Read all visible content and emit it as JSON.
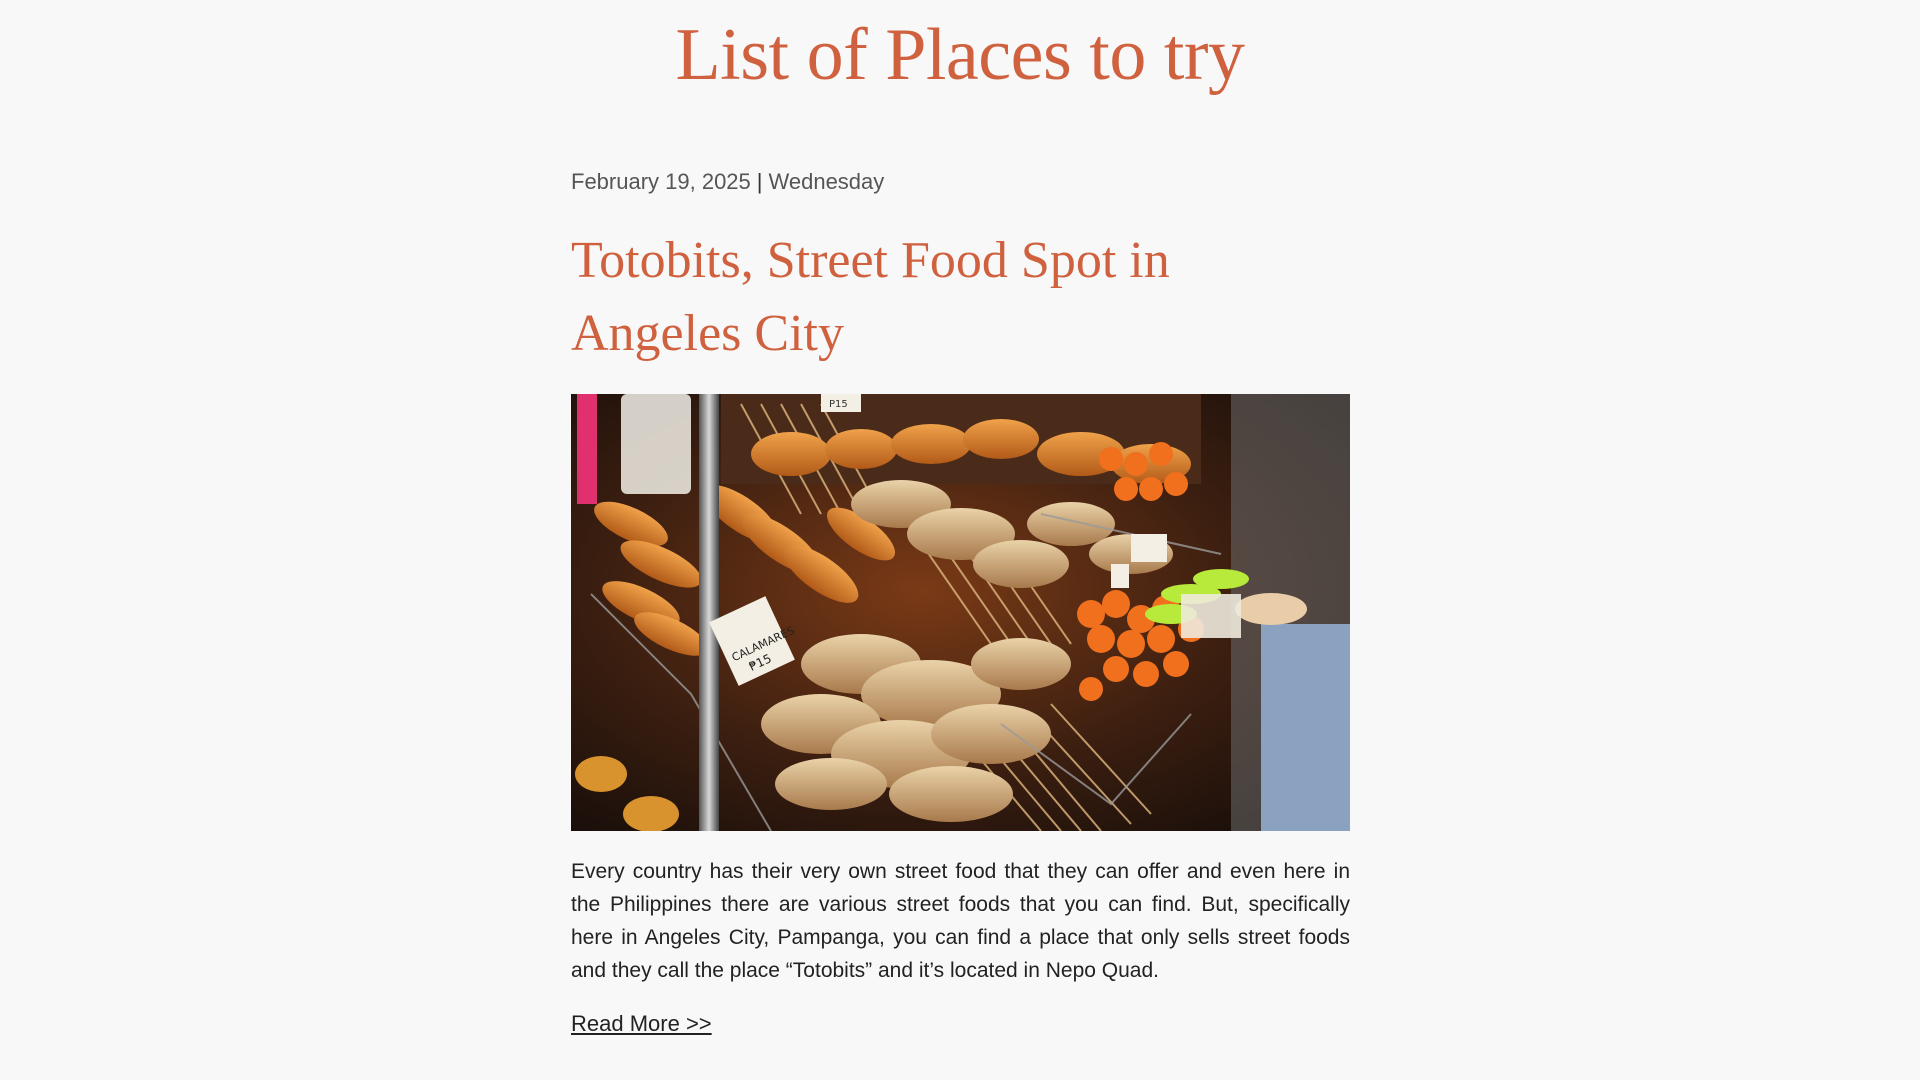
{
  "page": {
    "title": "List of Places to try"
  },
  "post": {
    "date": "February 19, 2025",
    "separator": "|",
    "weekday": "Wednesday",
    "title": "Totobits, Street Food Spot in Angeles City",
    "image_alt": "Street food stall with skewered fried foods",
    "excerpt": "Every country has their very own street food that they can offer and even here in the Philippines there are various street foods that you can find. But, specifically here in Angeles City, Pampanga, you can find a place that only sells street foods and they call the place “Totobits” and it’s located in Nepo Quad.",
    "read_more": "Read More >>",
    "image_signs": [
      "CALAMARES",
      "P15",
      "₱15"
    ]
  },
  "colors": {
    "background": "#f8f8f8",
    "accent": "#d0613f",
    "meta_text": "#555555",
    "body_text": "#222222"
  }
}
